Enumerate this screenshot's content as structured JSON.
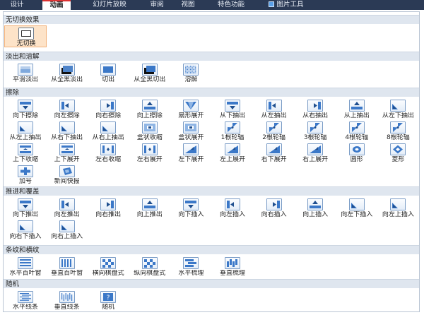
{
  "tabs": [
    {
      "id": "design",
      "label": "设计",
      "active": false
    },
    {
      "id": "animation",
      "label": "动画",
      "active": true
    },
    {
      "id": "slideshow",
      "label": "幻灯片放映",
      "active": false
    },
    {
      "id": "review",
      "label": "审阅",
      "active": false
    },
    {
      "id": "view",
      "label": "视图",
      "active": false
    },
    {
      "id": "special",
      "label": "特色功能",
      "active": false
    },
    {
      "id": "picture-tools",
      "label": "图片工具",
      "active": false
    }
  ],
  "colors": {
    "accent": "#d33",
    "tab_bg": "#2b3a55",
    "header_bg": "#dfe6ef",
    "icon_blue": "#3b78c8",
    "icon_dark": "#1f4f8f",
    "selected_bg": "#fde3c8"
  },
  "sections": [
    {
      "id": "none",
      "title": "无切换效果",
      "items": [
        {
          "label": "无切换",
          "icon": "none",
          "selected": true
        }
      ]
    },
    {
      "id": "fade",
      "title": "淡出和溶解",
      "items": [
        {
          "label": "平滑淡出",
          "icon": "fade"
        },
        {
          "label": "从全黑淡出",
          "icon": "fade-black"
        },
        {
          "label": "切出",
          "icon": "cut"
        },
        {
          "label": "从全黑切出",
          "icon": "cut-black"
        },
        {
          "label": "溶解",
          "icon": "dissolve"
        }
      ]
    },
    {
      "id": "wipe",
      "title": "擦除",
      "items": [
        {
          "label": "向下擦除",
          "icon": "arrow-down"
        },
        {
          "label": "向左擦除",
          "icon": "arrow-left"
        },
        {
          "label": "向右擦除",
          "icon": "arrow-right"
        },
        {
          "label": "向上擦除",
          "icon": "arrow-up"
        },
        {
          "label": "扇形展开",
          "icon": "fan"
        },
        {
          "label": "从下抽出",
          "icon": "arrow-down"
        },
        {
          "label": "从左抽出",
          "icon": "arrow-left"
        },
        {
          "label": "从右抽出",
          "icon": "arrow-right"
        },
        {
          "label": "从上抽出",
          "icon": "arrow-up"
        },
        {
          "label": "从左下抽出",
          "icon": "corner"
        },
        {
          "label": "从左上抽出",
          "icon": "corner"
        },
        {
          "label": "从右下抽出",
          "icon": "corner"
        },
        {
          "label": "从右上抽出",
          "icon": "corner"
        },
        {
          "label": "盒状收缩",
          "icon": "box"
        },
        {
          "label": "盒状展开",
          "icon": "box"
        },
        {
          "label": "1根轮辐",
          "icon": "spoke"
        },
        {
          "label": "2根轮辐",
          "icon": "spoke"
        },
        {
          "label": "3根轮辐",
          "icon": "spoke"
        },
        {
          "label": "4根轮辐",
          "icon": "spoke"
        },
        {
          "label": "8根轮辐",
          "icon": "spoke"
        },
        {
          "label": "上下收缩",
          "icon": "vsplit"
        },
        {
          "label": "上下展开",
          "icon": "vsplit"
        },
        {
          "label": "左右收缩",
          "icon": "hsplit"
        },
        {
          "label": "左右展开",
          "icon": "hsplit"
        },
        {
          "label": "左下展开",
          "icon": "diagonal"
        },
        {
          "label": "左上展开",
          "icon": "diagonal"
        },
        {
          "label": "右下展开",
          "icon": "diagonal"
        },
        {
          "label": "右上展开",
          "icon": "diagonal"
        },
        {
          "label": "圆形",
          "icon": "circle"
        },
        {
          "label": "菱形",
          "icon": "diamond"
        },
        {
          "label": "加号",
          "icon": "plus"
        },
        {
          "label": "新闻快报",
          "icon": "news"
        }
      ]
    },
    {
      "id": "push",
      "title": "推进和覆盖",
      "items": [
        {
          "label": "向下推出",
          "icon": "arrow-down"
        },
        {
          "label": "向左推出",
          "icon": "arrow-left"
        },
        {
          "label": "向右推出",
          "icon": "arrow-right"
        },
        {
          "label": "向上推出",
          "icon": "arrow-up"
        },
        {
          "label": "向下插入",
          "icon": "arrow-down"
        },
        {
          "label": "向左插入",
          "icon": "arrow-left"
        },
        {
          "label": "向右插入",
          "icon": "arrow-right"
        },
        {
          "label": "向上插入",
          "icon": "arrow-up"
        },
        {
          "label": "向左下插入",
          "icon": "corner"
        },
        {
          "label": "向左上插入",
          "icon": "corner"
        },
        {
          "label": "向右下插入",
          "icon": "corner"
        },
        {
          "label": "向右上插入",
          "icon": "corner"
        }
      ]
    },
    {
      "id": "stripes",
      "title": "条纹和横纹",
      "items": [
        {
          "label": "水平百叶窗",
          "icon": "hblinds"
        },
        {
          "label": "垂直百叶窗",
          "icon": "vblinds"
        },
        {
          "label": "横向棋盘式",
          "icon": "checker"
        },
        {
          "label": "纵向棋盘式",
          "icon": "checker"
        },
        {
          "label": "水平梳理",
          "icon": "hcomb"
        },
        {
          "label": "垂直梳理",
          "icon": "vcomb"
        }
      ]
    },
    {
      "id": "random",
      "title": "随机",
      "items": [
        {
          "label": "水平线条",
          "icon": "hlines"
        },
        {
          "label": "垂直线条",
          "icon": "vlines"
        },
        {
          "label": "随机",
          "icon": "question"
        }
      ]
    }
  ]
}
